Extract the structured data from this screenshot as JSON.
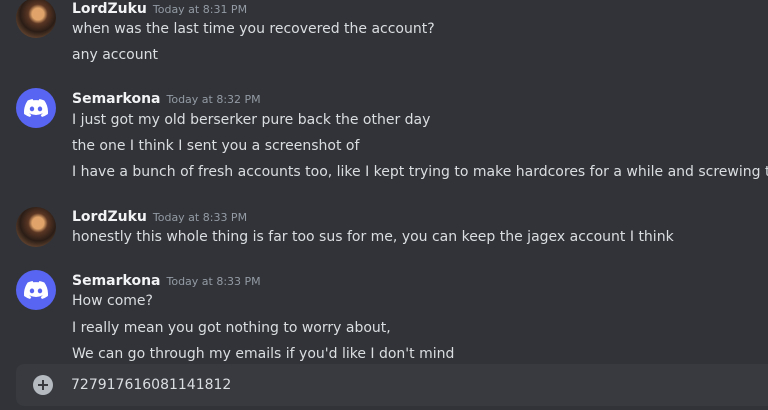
{
  "messages": [
    {
      "author": "LordZuku",
      "timestamp": "Today at 8:31 PM",
      "avatar": "user-avatar",
      "lines": [
        "when was the last time you recovered the account?",
        "any account"
      ]
    },
    {
      "author": "Semarkona",
      "timestamp": "Today at 8:32 PM",
      "avatar": "discord-logo-icon",
      "lines": [
        "I just got my old berserker pure back the other day",
        "the one I think I sent you a screenshot of",
        "I have a bunch of fresh accounts too, like I kept trying to make hardcores for a while and screwing them"
      ]
    },
    {
      "author": "LordZuku",
      "timestamp": "Today at 8:33 PM",
      "avatar": "user-avatar",
      "lines": [
        "honestly this whole thing is far too sus for me, you can keep the jagex account I think"
      ]
    },
    {
      "author": "Semarkona",
      "timestamp": "Today at 8:33 PM",
      "avatar": "discord-logo-icon",
      "lines": [
        "How come?",
        "I really mean you got nothing to worry about,",
        "We can go through my emails if you'd like I don't mind"
      ]
    }
  ],
  "composer": {
    "value": "727917616081141812",
    "icon": "add-attachment-icon"
  },
  "colors": {
    "background": "#313338",
    "composer": "#383a40",
    "blurple": "#5865f2",
    "author": "#f2f3f5",
    "timestamp": "#949ba4",
    "text": "#dbdee1"
  }
}
